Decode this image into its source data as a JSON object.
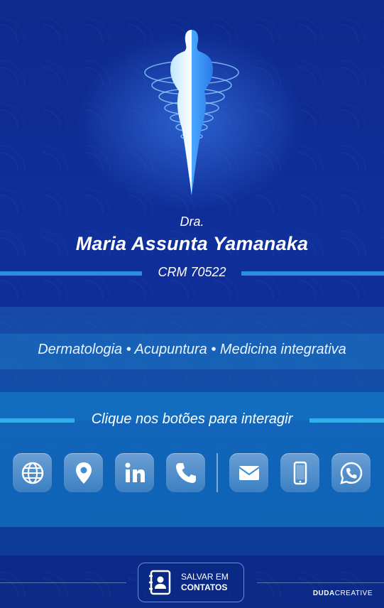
{
  "header": {
    "title_prefix": "Dra.",
    "name": "Maria Assunta Yamanaka",
    "crm": "CRM 70522"
  },
  "specialties": "Dermatologia • Acupuntura • Medicina integrativa",
  "prompt": "Clique nos botões para interagir",
  "buttons": [
    {
      "icon": "globe-icon"
    },
    {
      "icon": "map-pin-icon"
    },
    {
      "icon": "linkedin-icon"
    },
    {
      "icon": "phone-icon"
    },
    {
      "icon": "mail-icon"
    },
    {
      "icon": "mobile-icon"
    },
    {
      "icon": "whatsapp-icon"
    }
  ],
  "save": {
    "line1": "SALVAR EM",
    "line2": "CONTATOS"
  },
  "brand": {
    "bold": "DUDA",
    "regular": "CREATIVE"
  },
  "colors": {
    "background": "#0f2f9b",
    "accent_line": "#2a8fe0",
    "band": "#1a78c8"
  }
}
